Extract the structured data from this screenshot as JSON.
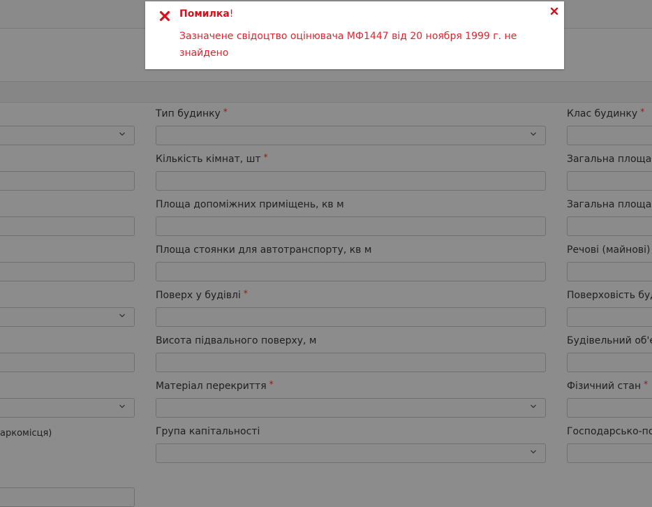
{
  "alert": {
    "title": "Помилка",
    "title_suffix": "!",
    "message": "Зазначене свідоцтво оцінювача МФ1447 від 20 ноября 1999 г. не знайдено",
    "color": "#e0242d"
  },
  "required_mark": "*",
  "left_column": {
    "partial_label": "аркомісця)"
  },
  "middle_column": [
    {
      "label": "Тип будинку",
      "required": true,
      "type": "select"
    },
    {
      "label": "Кількість кімнат, шт",
      "required": true,
      "type": "input"
    },
    {
      "label": "Площа допоміжних приміщень, кв м",
      "required": false,
      "type": "input"
    },
    {
      "label": "Площа стоянки для автотранспорту, кв м",
      "required": false,
      "type": "input"
    },
    {
      "label": "Поверх у будівлі",
      "required": true,
      "type": "input"
    },
    {
      "label": "Висота підвального поверху, м",
      "required": false,
      "type": "input"
    },
    {
      "label": "Матеріал перекриття",
      "required": true,
      "type": "select"
    },
    {
      "label": "Група капітальності",
      "required": false,
      "type": "select"
    }
  ],
  "right_column": [
    {
      "label": "Клас будинку",
      "required": true
    },
    {
      "label": "Загальна площа",
      "required": false
    },
    {
      "label": "Загальна площа",
      "required": false
    },
    {
      "label": "Речові (майнові) п",
      "required": false
    },
    {
      "label": "Поверховість буд",
      "required": false
    },
    {
      "label": "Будівельний об'є",
      "required": false
    },
    {
      "label": "Фізичний стан",
      "required": true
    },
    {
      "label": "Господарсько-по",
      "required": false
    }
  ]
}
